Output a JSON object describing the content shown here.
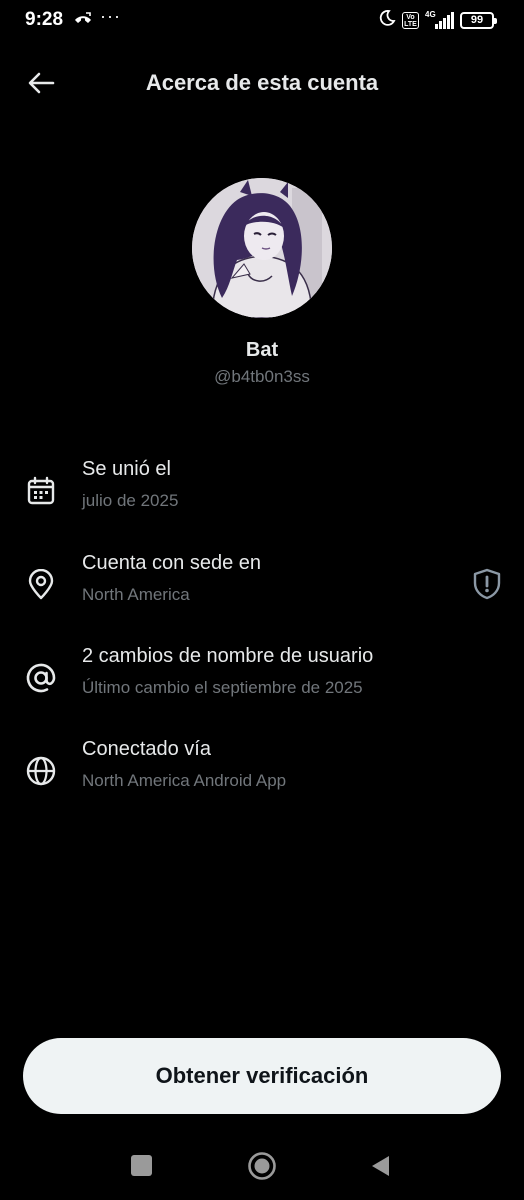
{
  "status_bar": {
    "time": "9:28",
    "dots": "···",
    "network": "4G",
    "volte": "Vo LTE",
    "battery": "99"
  },
  "header": {
    "title": "Acerca de esta cuenta"
  },
  "profile": {
    "display_name": "Bat",
    "handle": "@b4tb0n3ss"
  },
  "info": [
    {
      "icon": "calendar-icon",
      "title": "Se unió el",
      "subtitle": "julio de 2025"
    },
    {
      "icon": "location-pin-icon",
      "title": "Cuenta con sede en",
      "subtitle": "North America",
      "badge": "shield-alert-icon"
    },
    {
      "icon": "at-sign-icon",
      "title": "2 cambios de nombre de usuario",
      "subtitle": "Último cambio el septiembre de 2025"
    },
    {
      "icon": "globe-icon",
      "title": "Conectado vía",
      "subtitle": "North America Android App"
    }
  ],
  "cta": {
    "label": "Obtener verificación"
  },
  "colors": {
    "background": "#000000",
    "primary_text": "#e7e9ea",
    "secondary_text": "#71767b",
    "button_bg": "#eff3f4",
    "button_text": "#0f1419"
  }
}
